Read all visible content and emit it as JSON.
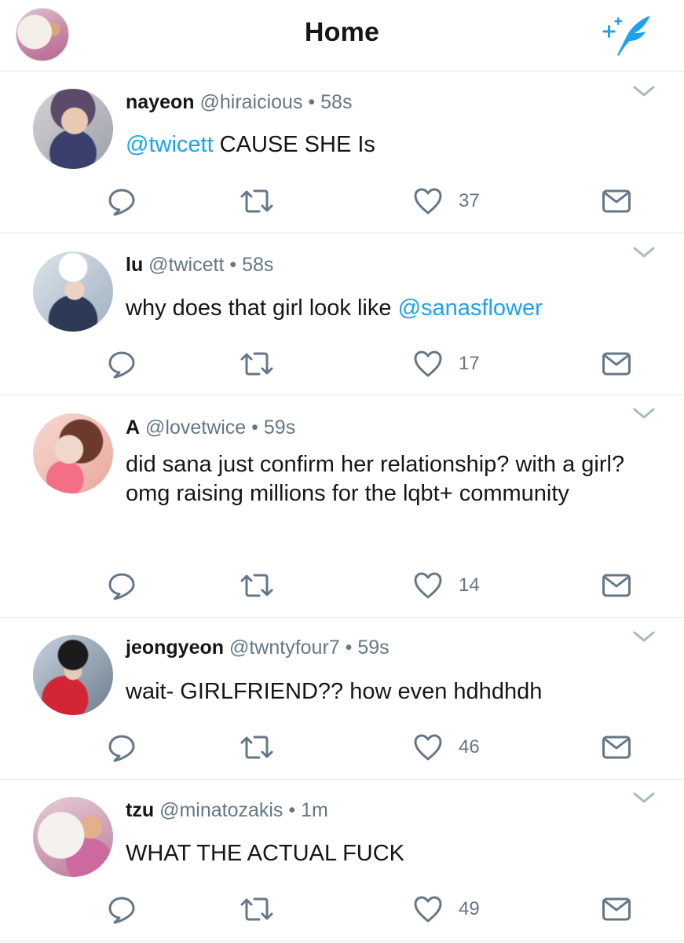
{
  "header": {
    "title": "Home",
    "compose_icon": "compose-quill-icon",
    "accent": "#1da1f2"
  },
  "colors": {
    "mention": "#1da1f2",
    "secondary_text": "#657786",
    "icon": "#657786",
    "divider": "#e1e8ed"
  },
  "tweets": [
    {
      "name": "nayeon",
      "handle": "@hiraicious",
      "separator": "•",
      "time": "58s",
      "body_mention": "@twicett",
      "body_text": " CAUSE SHE Is",
      "likes": "37"
    },
    {
      "name": "lu",
      "handle": "@twicett",
      "separator": "•",
      "time": "58s",
      "body_text": "why does that girl look like ",
      "body_mention": "@sanasflower",
      "likes": "17"
    },
    {
      "name": "A",
      "handle": "@lovetwice",
      "separator": "•",
      "time": "59s",
      "body_text": "did sana just confirm her relationship? with a girl? omg raising millions for the lqbt+ community",
      "likes": "14"
    },
    {
      "name": "jeongyeon",
      "handle": "@twntyfour7",
      "separator": "•",
      "time": "59s",
      "body_text": "wait- GIRLFRIEND?? how even hdhdhdh",
      "likes": "46"
    },
    {
      "name": "tzu",
      "handle": "@minatozakis",
      "separator": "•",
      "time": "1m",
      "body_text": "WHAT THE ACTUAL FUCK",
      "likes": "49"
    }
  ]
}
